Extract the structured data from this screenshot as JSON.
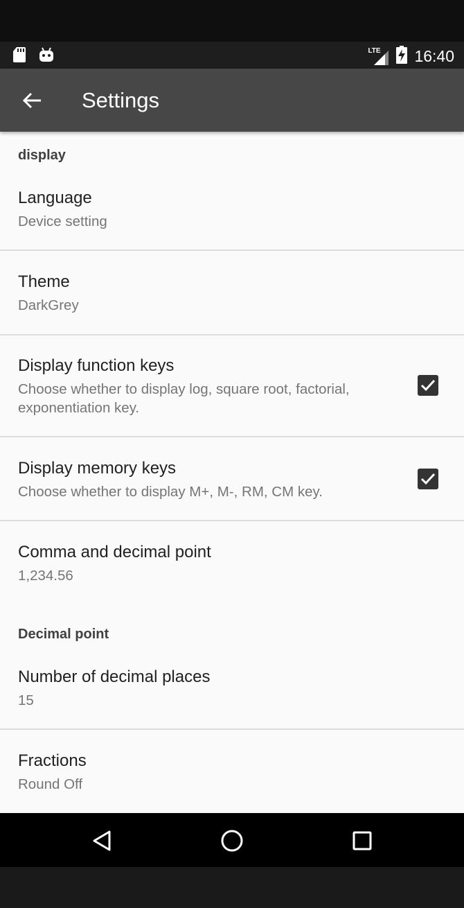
{
  "status_bar": {
    "time": "16:40",
    "network": "LTE",
    "icons": [
      "sd-card-icon",
      "android-icon",
      "signal-icon",
      "battery-charging-icon"
    ]
  },
  "app_bar": {
    "title": "Settings",
    "back_icon": "arrow-back-icon"
  },
  "sections": [
    {
      "header": "display",
      "items": [
        {
          "title": "Language",
          "summary": "Device setting"
        },
        {
          "title": "Theme",
          "summary": "DarkGrey"
        },
        {
          "title": "Display function keys",
          "summary": "Choose whether to display log, square root, factorial, exponentiation key.",
          "checked": true
        },
        {
          "title": "Display memory keys",
          "summary": "Choose whether to display M+, M-, RM, CM key.",
          "checked": true
        },
        {
          "title": "Comma and decimal point",
          "summary": "1,234.56"
        }
      ]
    },
    {
      "header": "Decimal point",
      "items": [
        {
          "title": "Number of decimal places",
          "summary": "15"
        },
        {
          "title": "Fractions",
          "summary": "Round Off"
        }
      ]
    }
  ],
  "nav_bar": {
    "buttons": [
      "back-triangle-icon",
      "home-circle-icon",
      "recents-square-icon"
    ]
  },
  "colors": {
    "app_bar": "#474747",
    "background": "#fafafa",
    "checkbox": "#333333"
  }
}
